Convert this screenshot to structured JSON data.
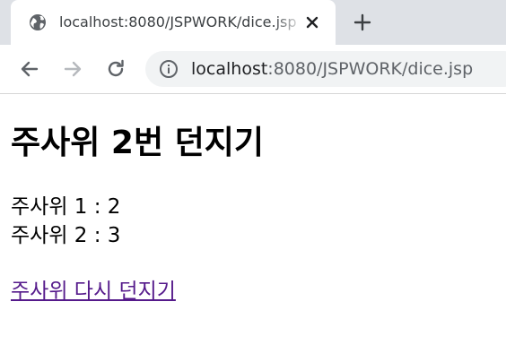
{
  "browser": {
    "tab": {
      "title": "localhost:8080/JSPWORK/dice.jsp"
    },
    "address": {
      "host": "localhost",
      "path": ":8080/JSPWORK/dice.jsp"
    }
  },
  "page": {
    "heading": "주사위 2번 던지기",
    "rolls": [
      {
        "label": "주사위 1 : 2"
      },
      {
        "label": "주사위 2 : 3"
      }
    ],
    "link_label": "주사위 다시 던지기"
  },
  "colors": {
    "tabstrip": "#dee1e6",
    "omnibox": "#f1f3f4",
    "visited_link": "#551a8b"
  }
}
